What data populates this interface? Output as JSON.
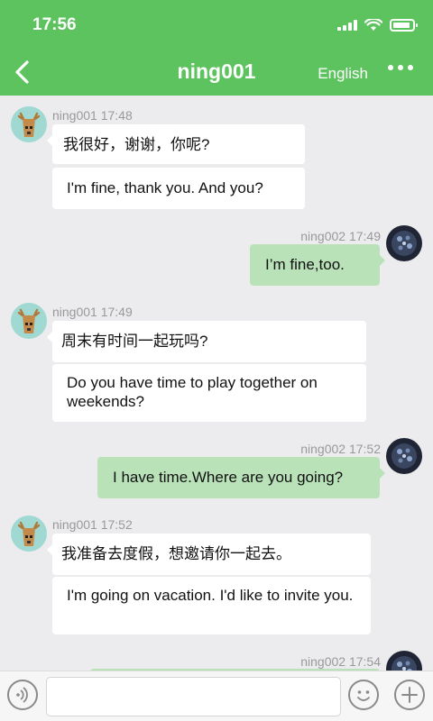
{
  "status": {
    "time": "17:56"
  },
  "header": {
    "title": "ning001",
    "language": "English"
  },
  "icons": {
    "back": "back-arrow-icon",
    "more": "more-dots-icon",
    "voice": "voice-icon",
    "emoji": "emoji-icon",
    "plus": "plus-icon"
  },
  "colors": {
    "header": "#5cc35e",
    "own_bubble": "#b9e2b9",
    "background": "#ececef"
  },
  "messages": [
    {
      "side": "left",
      "meta": "ning001 17:48",
      "original": "我很好，谢谢，你呢?",
      "translation": "I'm fine, thank you. And you?"
    },
    {
      "side": "right",
      "meta": "ning002 17:49",
      "text": "I’m fine,too."
    },
    {
      "side": "left",
      "meta": "ning001 17:49",
      "original": "周末有时间一起玩吗?",
      "translation": "Do you have time to play together on weekends?"
    },
    {
      "side": "right",
      "meta": "ning002 17:52",
      "text": "I have time.Where are you going?"
    },
    {
      "side": "left",
      "meta": "ning001 17:52",
      "original": "我准备去度假，想邀请你一起去。",
      "translation": "I'm going on vacation. I'd like to invite you."
    },
    {
      "side": "right",
      "meta": "ning002 17:54",
      "text": ""
    }
  ],
  "input": {
    "value": ""
  }
}
